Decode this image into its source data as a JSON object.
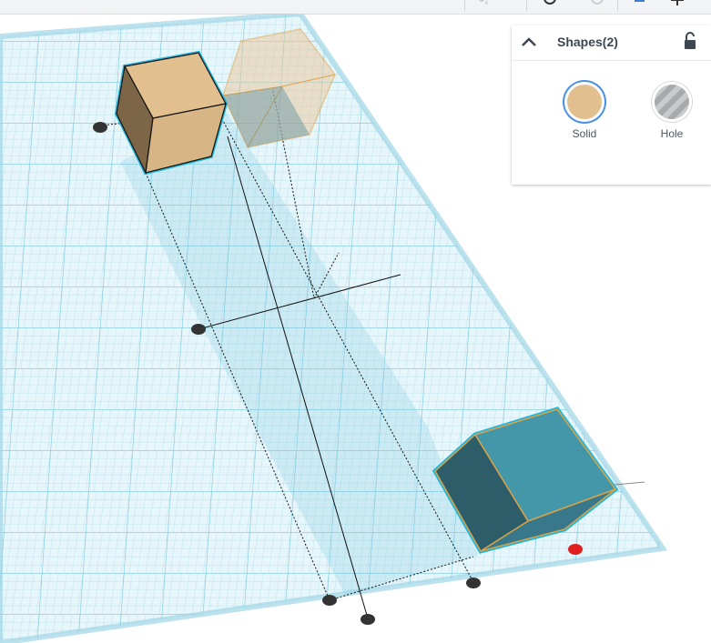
{
  "toolbar": {
    "icons": [
      "light-icon",
      "rotate-icon",
      "ring-icon",
      "align-icon",
      "mirror-icon"
    ]
  },
  "workplane": {
    "grid_color": "#a8dbe8",
    "plane_fill": "#cfeef6",
    "plane_edge": "#5ec3da",
    "selected_outline": "#23b5dc",
    "solid_color": "#e2bf8f",
    "hole_color": "#3a8fa0",
    "handle_color": "#333333",
    "active_handle_color": "#e02020"
  },
  "shapes_panel": {
    "title": "Shapes(2)",
    "options": [
      {
        "label": "Solid",
        "icon": "solid-swatch",
        "selected": true
      },
      {
        "label": "Hole",
        "icon": "hole-swatch",
        "selected": false
      }
    ]
  }
}
